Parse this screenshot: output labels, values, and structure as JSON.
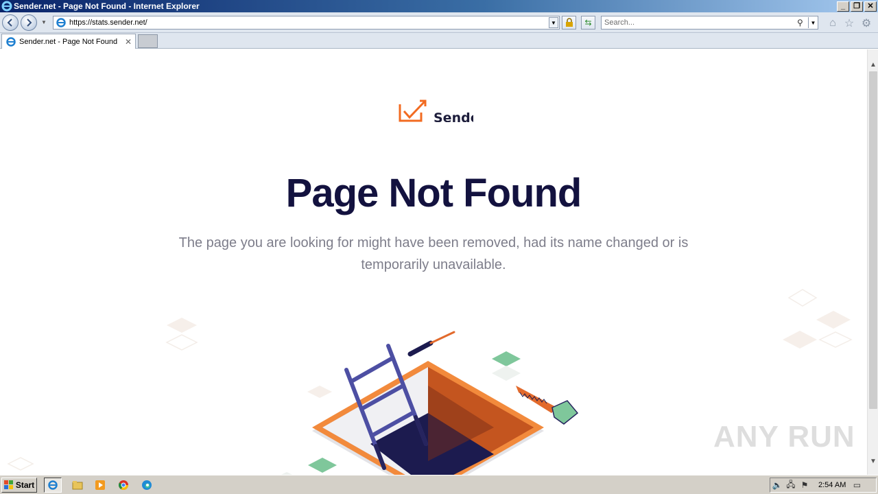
{
  "window": {
    "title": "Sender.net - Page Not Found - Internet Explorer",
    "minimize": "_",
    "restore": "❐",
    "close": "✕"
  },
  "navbar": {
    "url": "https://stats.sender.net/",
    "search_placeholder": "Search..."
  },
  "tabs": [
    {
      "label": "Sender.net - Page Not Found",
      "close": "✕"
    }
  ],
  "page": {
    "logo_text": "Sender",
    "heading": "Page Not Found",
    "subtext_line1": "The page you are looking for might have been removed, had its name changed or is",
    "subtext_line2": "temporarily unavailable."
  },
  "watermark": "ANY RUN",
  "taskbar": {
    "start_label": "Start",
    "clock": "2:54 AM"
  },
  "colors": {
    "heading": "#13123f",
    "subtext": "#7d7d8a",
    "brand_orange": "#f26b21",
    "hole_dark": "#1c1b4f",
    "ladder": "#4d4fa3",
    "green_tile": "#7fc79b"
  }
}
